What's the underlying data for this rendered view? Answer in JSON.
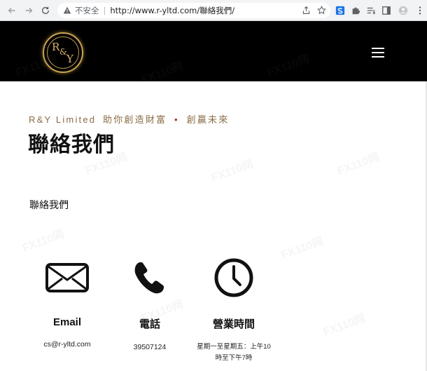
{
  "browser": {
    "security_label": "不安全",
    "url": "http://www.r-yltd.com/聯絡我們/"
  },
  "site": {
    "logo_letters": [
      "R",
      "&",
      "Y"
    ],
    "tagline_brand": "R&Y Limited",
    "tagline_motto_1": "助你創造財富",
    "tagline_bullet": "•",
    "tagline_motto_2": "創贏未來",
    "page_title": "聯絡我們",
    "section_title": "聯絡我們"
  },
  "contacts": {
    "email": {
      "label": "Email",
      "value": "cs@r-yltd.com"
    },
    "phone": {
      "label": "電話",
      "value": "39507124"
    },
    "hours": {
      "label": "營業時間",
      "value_line1": "星期一至星期五：上午10",
      "value_line2": "時至下午7時"
    }
  },
  "watermark": {
    "text": "FX110网"
  },
  "colors": {
    "header_bg": "#000000",
    "gold": "#c9a452",
    "tagline": "#8a6d45",
    "accent_red": "#b0302a"
  }
}
